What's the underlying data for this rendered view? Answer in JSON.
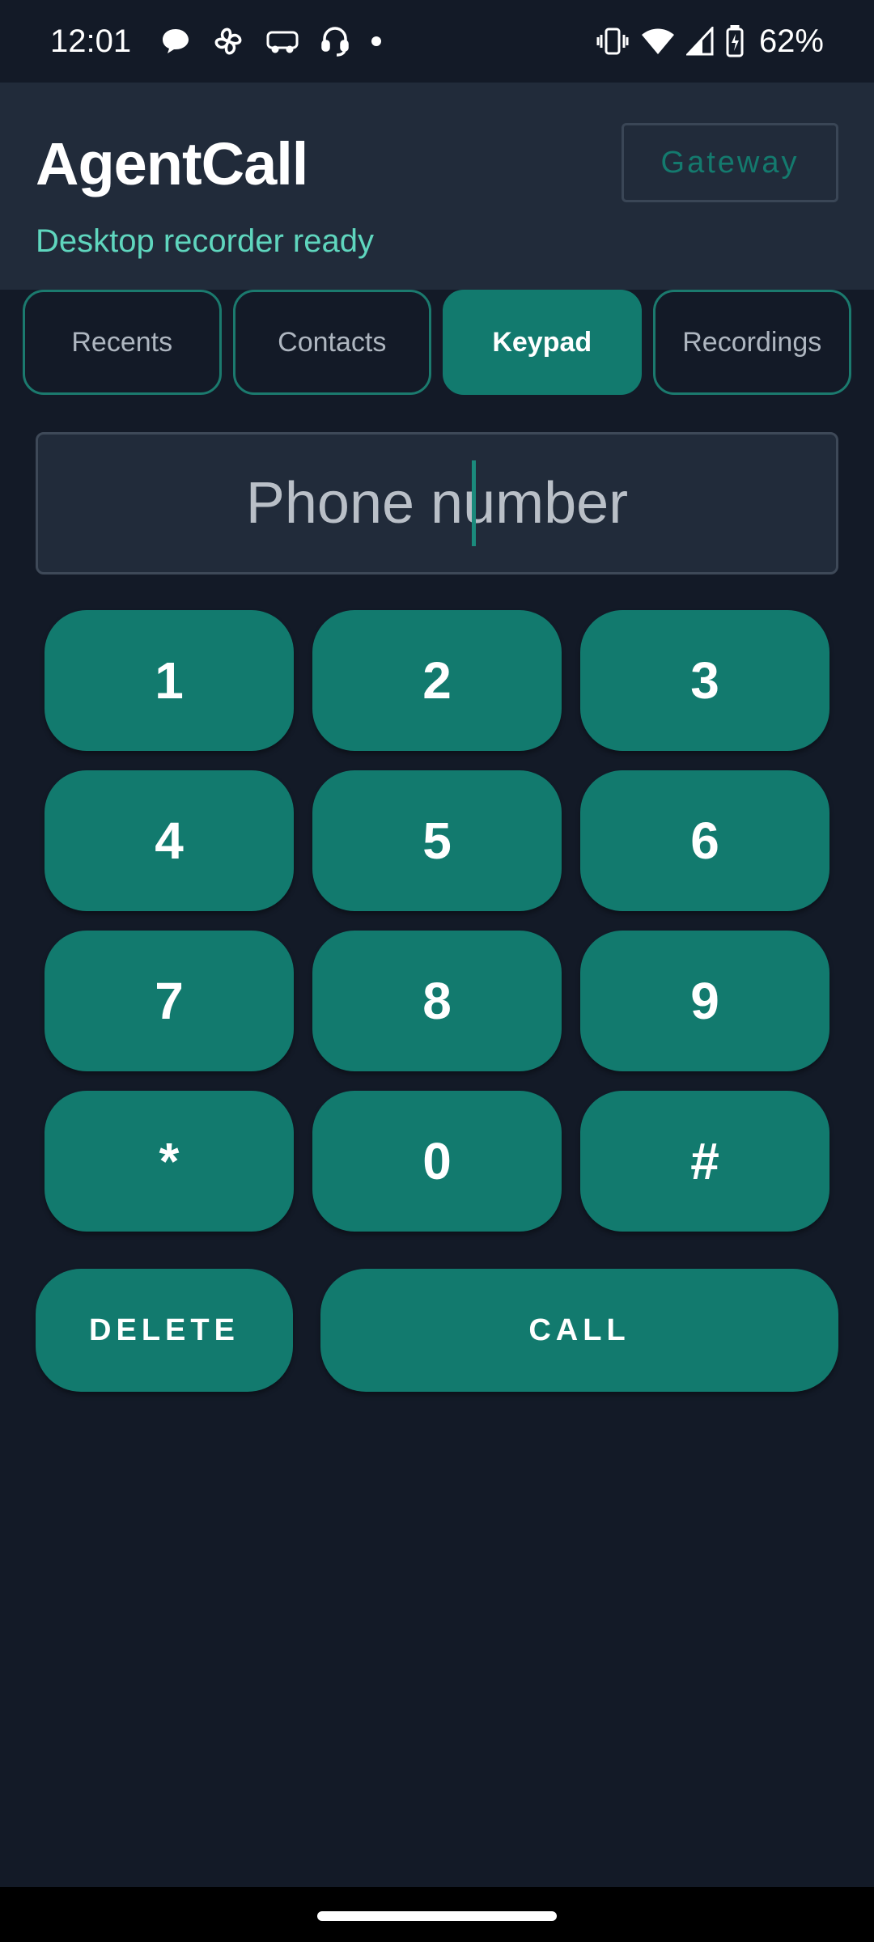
{
  "status_bar": {
    "time": "12:01",
    "notification_icons": [
      "chat-bubble-icon",
      "pinwheel-icon",
      "redbus-icon",
      "headset-icon",
      "dot-icon"
    ],
    "battery_percent": "62%"
  },
  "header": {
    "title": "AgentCall",
    "subtitle": "Desktop recorder ready",
    "gateway_label": "Gateway"
  },
  "tabs": [
    {
      "label": "Recents",
      "active": false
    },
    {
      "label": "Contacts",
      "active": false
    },
    {
      "label": "Keypad",
      "active": true
    },
    {
      "label": "Recordings",
      "active": false
    }
  ],
  "phone_input": {
    "placeholder": "Phone number",
    "value": ""
  },
  "keypad": {
    "keys": [
      "1",
      "2",
      "3",
      "4",
      "5",
      "6",
      "7",
      "8",
      "9",
      "*",
      "0",
      "#"
    ]
  },
  "actions": {
    "delete_label": "DELETE",
    "call_label": "CALL"
  },
  "colors": {
    "background": "#131a27",
    "header": "#212b3a",
    "accent": "#127a6e",
    "subtitle": "#5fd6be"
  }
}
